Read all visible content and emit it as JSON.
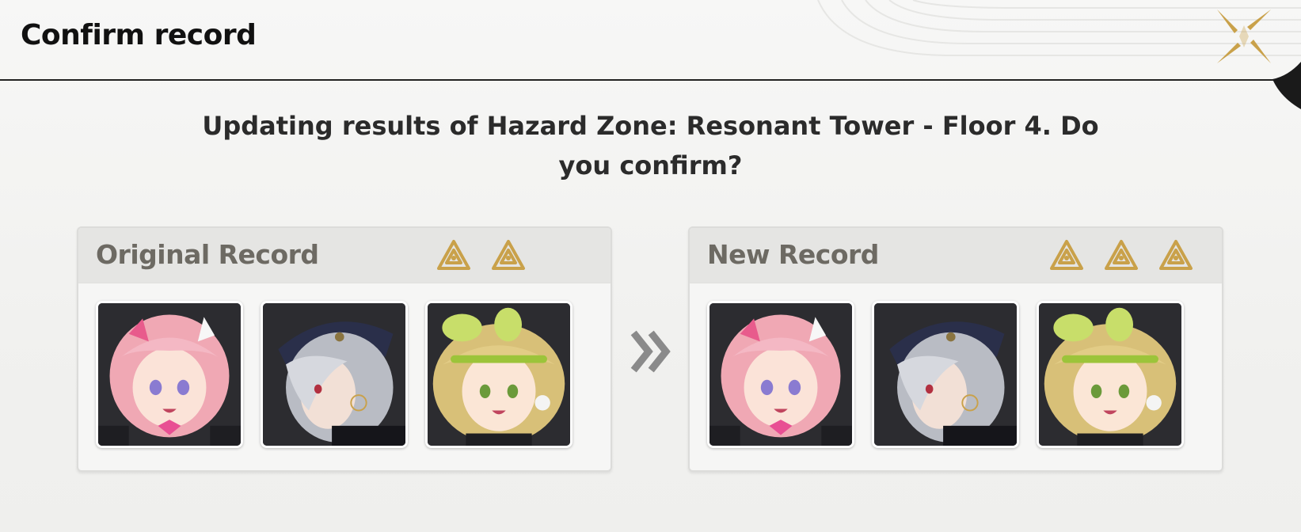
{
  "dialog": {
    "title": "Confirm record",
    "close_icon": "close-x-icon",
    "message": "Updating results of Hazard Zone: Resonant Tower - Floor 4. Do you confirm?"
  },
  "original_record": {
    "label": "Original Record",
    "rating_icons": 2,
    "characters": [
      "pink-haired-character",
      "silver-haired-character",
      "blonde-haired-character"
    ]
  },
  "new_record": {
    "label": "New Record",
    "rating_icons": 3,
    "characters": [
      "pink-haired-character",
      "silver-haired-character",
      "blonde-haired-character"
    ]
  },
  "arrow_icon": "double-chevron-right-icon",
  "colors": {
    "gold": "#c9a14a",
    "title_text": "#111111",
    "panel_label": "#6d6a63"
  }
}
